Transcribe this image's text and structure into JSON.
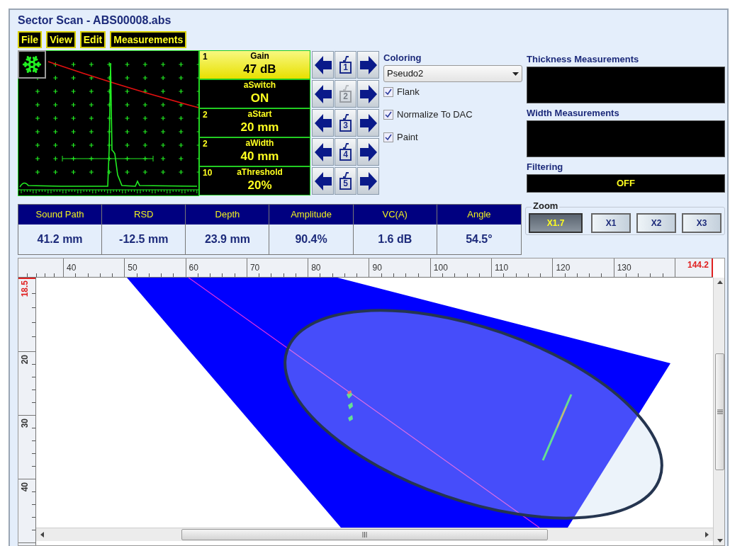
{
  "window": {
    "title": "Sector Scan - ABS00008.abs"
  },
  "menu": [
    "File",
    "View",
    "Edit",
    "Measurements"
  ],
  "parameters": [
    {
      "number": "1",
      "name": "Gain",
      "value": "47 dB",
      "selected": true,
      "key": "1",
      "disabled": false
    },
    {
      "name": "aSwitch",
      "value": "ON",
      "selected": false,
      "key": "2",
      "disabled": true
    },
    {
      "number": "2",
      "name": "aStart",
      "value": "20 mm",
      "selected": false,
      "key": "3",
      "disabled": false
    },
    {
      "number": "2",
      "name": "aWidth",
      "value": "40 mm",
      "selected": false,
      "key": "4",
      "disabled": false
    },
    {
      "number": "10",
      "name": "aThreshold",
      "value": "20%",
      "selected": false,
      "key": "5",
      "disabled": false
    }
  ],
  "coloring": {
    "label": "Coloring",
    "value": "Pseudo2",
    "options": [
      {
        "label": "Flank",
        "checked": true
      },
      {
        "label": "Normalize To DAC",
        "checked": true
      },
      {
        "label": "Paint",
        "checked": true
      }
    ]
  },
  "thickness": {
    "label": "Thickness Measurements"
  },
  "width": {
    "label": "Width Measurements"
  },
  "filtering": {
    "label": "Filtering",
    "value": "OFF"
  },
  "zoom": {
    "label": "Zoom",
    "buttons": [
      {
        "label": "X1.7",
        "selected": true
      },
      {
        "label": "X1",
        "selected": false
      },
      {
        "label": "X2",
        "selected": false
      },
      {
        "label": "X3",
        "selected": false
      }
    ]
  },
  "measurements": [
    {
      "label": "Sound Path",
      "value": "41.2 mm"
    },
    {
      "label": "RSD",
      "value": "-12.5 mm"
    },
    {
      "label": "Depth",
      "value": "23.9 mm"
    },
    {
      "label": "Amplitude",
      "value": "90.4%"
    },
    {
      "label": "VC(A)",
      "value": "1.6 dB"
    },
    {
      "label": "Angle",
      "value": "54.5°"
    }
  ],
  "scan": {
    "x_ruler": {
      "labels": [
        "40",
        "50",
        "60",
        "70",
        "80",
        "90",
        "100",
        "110",
        "120",
        "130"
      ],
      "cursor": "144.2"
    },
    "y_ruler": {
      "cursor": "18.5",
      "labels": [
        "20",
        "30",
        "40"
      ]
    }
  }
}
